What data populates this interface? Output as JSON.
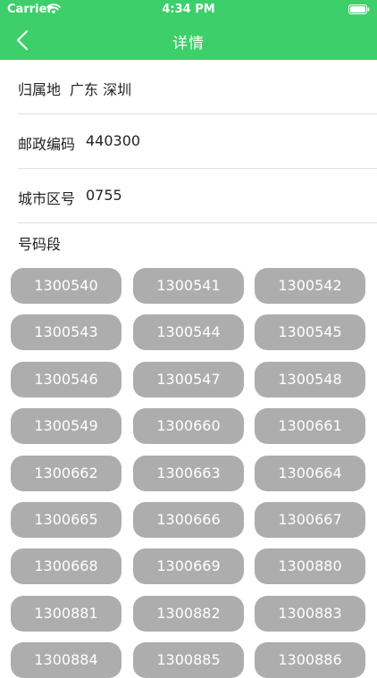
{
  "status": {
    "carrier": "Carrier",
    "time": "4:34 PM"
  },
  "nav": {
    "title": "详情"
  },
  "details": [
    {
      "label": "归属地",
      "value": "广东 深圳"
    },
    {
      "label": "邮政编码",
      "value": "440300"
    },
    {
      "label": "城市区号",
      "value": "0755"
    }
  ],
  "section_title": "号码段",
  "segments": [
    "1300540",
    "1300541",
    "1300542",
    "1300543",
    "1300544",
    "1300545",
    "1300546",
    "1300547",
    "1300548",
    "1300549",
    "1300660",
    "1300661",
    "1300662",
    "1300663",
    "1300664",
    "1300665",
    "1300666",
    "1300667",
    "1300668",
    "1300669",
    "1300880",
    "1300881",
    "1300882",
    "1300883",
    "1300884",
    "1300885",
    "1300886"
  ]
}
